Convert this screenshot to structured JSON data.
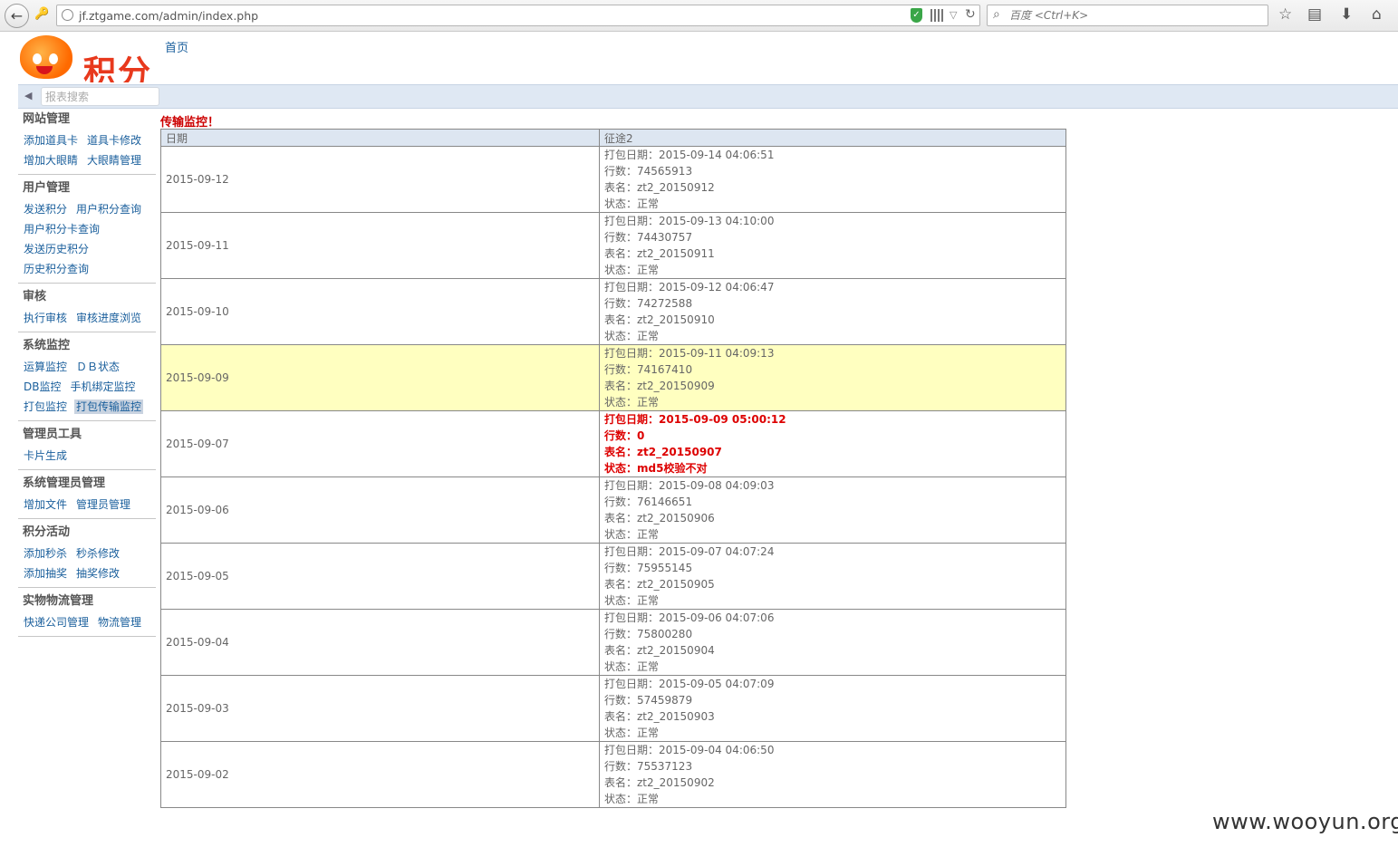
{
  "browser": {
    "url": "jf.ztgame.com/admin/index.php",
    "search_placeholder": "百度 <Ctrl+K>"
  },
  "page": {
    "home_link": "首页",
    "report_search_placeholder": "报表搜索",
    "title": "传输监控！",
    "watermark": "www.wooyun.org"
  },
  "sidebar": {
    "sections": [
      {
        "title": "网站管理",
        "rows": [
          [
            "添加道具卡",
            "道具卡修改"
          ],
          [
            "增加大眼睛",
            "大眼睛管理"
          ]
        ]
      },
      {
        "title": "用户管理",
        "rows": [
          [
            "发送积分",
            "用户积分查询"
          ],
          [
            "用户积分卡查询"
          ],
          [
            "发送历史积分"
          ],
          [
            "历史积分查询"
          ]
        ]
      },
      {
        "title": "审核",
        "rows": [
          [
            "执行审核",
            "审核进度浏览"
          ]
        ]
      },
      {
        "title": "系统监控",
        "rows": [
          [
            "运算监控",
            "ＤＢ状态"
          ],
          [
            "DB监控",
            "手机绑定监控"
          ],
          [
            "打包监控",
            "打包传输监控"
          ]
        ]
      },
      {
        "title": "管理员工具",
        "rows": [
          [
            "卡片生成"
          ]
        ]
      },
      {
        "title": "系统管理员管理",
        "rows": [
          [
            "增加文件",
            "管理员管理"
          ]
        ]
      },
      {
        "title": "积分活动",
        "rows": [
          [
            "添加秒杀",
            "秒杀修改"
          ],
          [
            "添加抽奖",
            "抽奖修改"
          ]
        ]
      },
      {
        "title": "实物物流管理",
        "rows": [
          [
            "快递公司管理",
            "物流管理"
          ]
        ]
      }
    ],
    "active": "打包传输监控"
  },
  "table": {
    "headers": [
      "日期",
      "征途2"
    ],
    "rows": [
      {
        "date": "2015-09-12",
        "lines": [
          "打包日期：2015-09-14 04:06:51",
          "行数：74565913",
          "表名：zt2_20150912",
          "状态：正常"
        ]
      },
      {
        "date": "2015-09-11",
        "lines": [
          "打包日期：2015-09-13 04:10:00",
          "行数：74430757",
          "表名：zt2_20150911",
          "状态：正常"
        ]
      },
      {
        "date": "2015-09-10",
        "lines": [
          "打包日期：2015-09-12 04:06:47",
          "行数：74272588",
          "表名：zt2_20150910",
          "状态：正常"
        ]
      },
      {
        "date": "2015-09-09",
        "lines": [
          "打包日期：2015-09-11 04:09:13",
          "行数：74167410",
          "表名：zt2_20150909",
          "状态：正常"
        ],
        "highlight": true
      },
      {
        "date": "2015-09-07",
        "lines": [
          "打包日期：2015-09-09 05:00:12",
          "行数：0",
          "表名：zt2_20150907",
          "状态：md5校验不对"
        ],
        "error": true
      },
      {
        "date": "2015-09-06",
        "lines": [
          "打包日期：2015-09-08 04:09:03",
          "行数：76146651",
          "表名：zt2_20150906",
          "状态：正常"
        ]
      },
      {
        "date": "2015-09-05",
        "lines": [
          "打包日期：2015-09-07 04:07:24",
          "行数：75955145",
          "表名：zt2_20150905",
          "状态：正常"
        ]
      },
      {
        "date": "2015-09-04",
        "lines": [
          "打包日期：2015-09-06 04:07:06",
          "行数：75800280",
          "表名：zt2_20150904",
          "状态：正常"
        ]
      },
      {
        "date": "2015-09-03",
        "lines": [
          "打包日期：2015-09-05 04:07:09",
          "行数：57459879",
          "表名：zt2_20150903",
          "状态：正常"
        ]
      },
      {
        "date": "2015-09-02",
        "lines": [
          "打包日期：2015-09-04 04:06:50",
          "行数：75537123",
          "表名：zt2_20150902",
          "状态：正常"
        ]
      }
    ]
  }
}
